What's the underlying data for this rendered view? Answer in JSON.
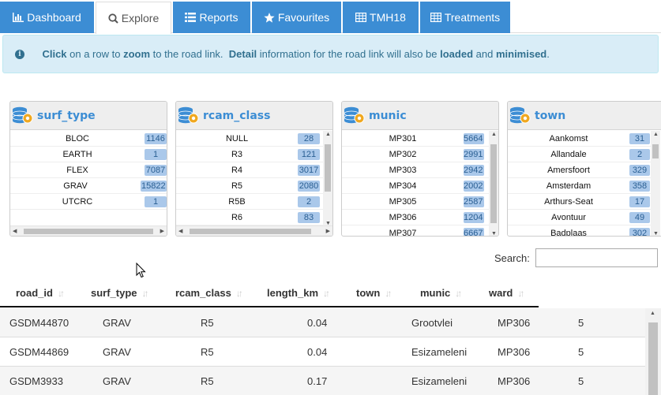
{
  "tabs": [
    {
      "label": "Dashboard",
      "icon": "bar-chart-icon"
    },
    {
      "label": "Explore",
      "icon": "search-icon"
    },
    {
      "label": "Reports",
      "icon": "list-icon"
    },
    {
      "label": "Favourites",
      "icon": "star-icon"
    },
    {
      "label": "TMH18",
      "icon": "table-icon"
    },
    {
      "label": "Treatments",
      "icon": "table-icon"
    }
  ],
  "info": {
    "t1": "Click",
    "t2": " on a row to ",
    "t3": "zoom",
    "t4": " to the road link.  ",
    "t5": "Detail",
    "t6": " information for the road link will also be ",
    "t7": "loaded",
    "t8": " and ",
    "t9": "minimised",
    "t10": "."
  },
  "filters": [
    {
      "title": "surf_type",
      "rows": [
        {
          "label": "BLOC",
          "count": "1146"
        },
        {
          "label": "EARTH",
          "count": "1"
        },
        {
          "label": "FLEX",
          "count": "7087"
        },
        {
          "label": "GRAV",
          "count": "15822"
        },
        {
          "label": "UTCRC",
          "count": "1"
        }
      ]
    },
    {
      "title": "rcam_class",
      "rows": [
        {
          "label": "NULL",
          "count": "28"
        },
        {
          "label": "R3",
          "count": "121"
        },
        {
          "label": "R4",
          "count": "3017"
        },
        {
          "label": "R5",
          "count": "2080"
        },
        {
          "label": "R5B",
          "count": "2"
        },
        {
          "label": "R6",
          "count": "83"
        }
      ]
    },
    {
      "title": "munic",
      "rows": [
        {
          "label": "MP301",
          "count": "5664"
        },
        {
          "label": "MP302",
          "count": "2991"
        },
        {
          "label": "MP303",
          "count": "2942"
        },
        {
          "label": "MP304",
          "count": "2002"
        },
        {
          "label": "MP305",
          "count": "2587"
        },
        {
          "label": "MP306",
          "count": "1204"
        },
        {
          "label": "MP307",
          "count": "6667"
        }
      ]
    },
    {
      "title": "town",
      "rows": [
        {
          "label": "Aankomst",
          "count": "31"
        },
        {
          "label": "Allandale",
          "count": "2"
        },
        {
          "label": "Amersfoort",
          "count": "329"
        },
        {
          "label": "Amsterdam",
          "count": "358"
        },
        {
          "label": "Arthurs-Seat",
          "count": "17"
        },
        {
          "label": "Avontuur",
          "count": "49"
        },
        {
          "label": "Badplaas",
          "count": "302"
        }
      ]
    }
  ],
  "search": {
    "label": "Search:",
    "value": ""
  },
  "table": {
    "columns": [
      "road_id",
      "surf_type",
      "rcam_class",
      "length_km",
      "town",
      "munic",
      "ward"
    ],
    "rows": [
      [
        "GSDM44870",
        "GRAV",
        "R5",
        "0.04",
        "Grootvlei",
        "MP306",
        "5"
      ],
      [
        "GSDM44869",
        "GRAV",
        "R5",
        "0.04",
        "Esizameleni",
        "MP306",
        "5"
      ],
      [
        "GSDM3933",
        "GRAV",
        "R5",
        "0.17",
        "Esizameleni",
        "MP306",
        "5"
      ]
    ]
  },
  "colors": {
    "accent": "#3c8dd4",
    "info_bg": "#d9edf7",
    "info_text": "#31708f",
    "count_bg": "#aac8ea"
  }
}
